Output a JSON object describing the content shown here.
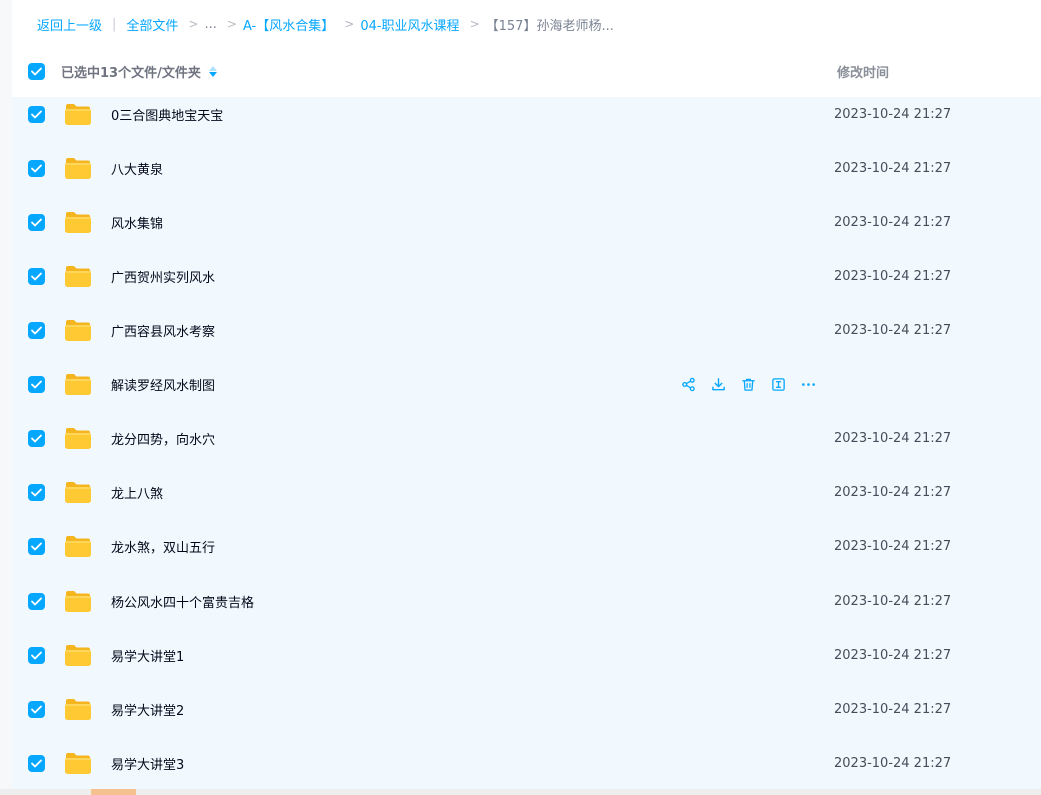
{
  "breadcrumb": {
    "back": "返回上一级",
    "root": "全部文件",
    "ellipsis": "...",
    "level1": "A-【风水合集】",
    "level2": "04-职业风水课程",
    "current": "【157】孙海老师杨..."
  },
  "header": {
    "selected_label": "已选中13个文件/文件夹",
    "time_label": "修改时间"
  },
  "colors": {
    "accent": "#06a7ff",
    "folder": "#ffc933",
    "selected_row_bg": "#f2f9fe"
  },
  "icons": {
    "row_icon": "folder-icon",
    "checkbox": "checkmark-icon",
    "actions": [
      "share-icon",
      "download-icon",
      "trash-icon",
      "rename-icon",
      "more-icon"
    ]
  },
  "files": [
    {
      "name": "0三合图典地宝天宝",
      "time": "2023-10-24 21:27"
    },
    {
      "name": "八大黄泉",
      "time": "2023-10-24 21:27"
    },
    {
      "name": "风水集锦",
      "time": "2023-10-24 21:27"
    },
    {
      "name": "广西贺州实列风水",
      "time": "2023-10-24 21:27"
    },
    {
      "name": "广西容县风水考察",
      "time": "2023-10-24 21:27"
    },
    {
      "name": "解读罗经风水制图",
      "time": ""
    },
    {
      "name": "龙分四势，向水穴",
      "time": "2023-10-24 21:27"
    },
    {
      "name": "龙上八煞",
      "time": "2023-10-24 21:27"
    },
    {
      "name": "龙水煞，双山五行",
      "time": "2023-10-24 21:27"
    },
    {
      "name": "杨公风水四十个富贵吉格",
      "time": "2023-10-24 21:27"
    },
    {
      "name": "易学大讲堂1",
      "time": "2023-10-24 21:27"
    },
    {
      "name": "易学大讲堂2",
      "time": "2023-10-24 21:27"
    },
    {
      "name": "易学大讲堂3",
      "time": "2023-10-24 21:27"
    }
  ]
}
